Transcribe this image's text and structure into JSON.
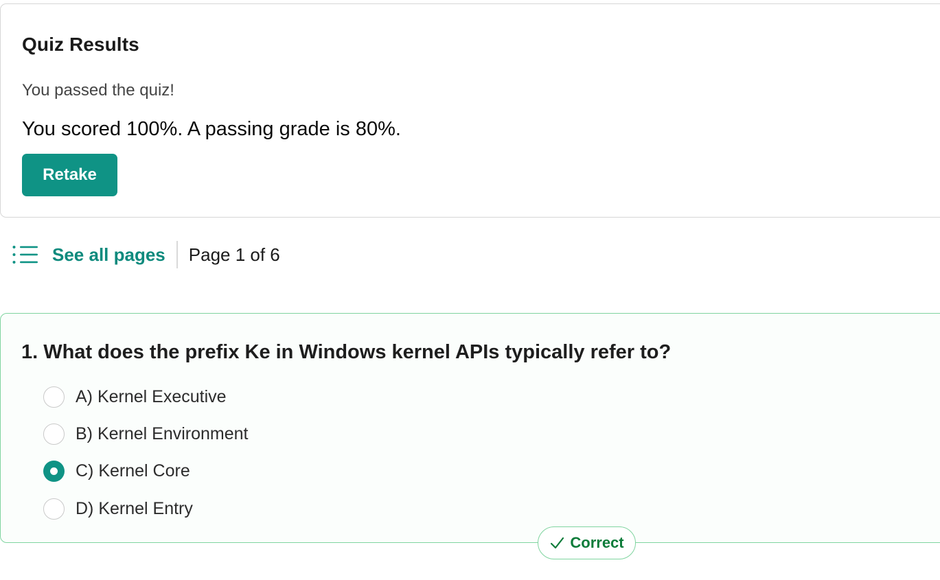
{
  "results": {
    "title": "Quiz Results",
    "status": "You passed the quiz!",
    "score_text": "You scored 100%. A passing grade is 80%.",
    "retake_label": "Retake"
  },
  "pager": {
    "icon": "list-icon",
    "see_all_label": "See all pages",
    "page_label": "Page 1 of 6"
  },
  "question": {
    "text": "1. What does the prefix Ke in Windows kernel APIs typically refer to?",
    "options": [
      {
        "label": "A) Kernel Executive",
        "selected": false
      },
      {
        "label": "B) Kernel Environment",
        "selected": false
      },
      {
        "label": "C) Kernel Core",
        "selected": true
      },
      {
        "label": "D) Kernel Entry",
        "selected": false
      }
    ],
    "result_badge": "Correct",
    "result_icon": "check-icon"
  },
  "colors": {
    "accent": "#0f9385",
    "correct_border": "#7fd49f",
    "correct_text": "#0e7c3a"
  }
}
